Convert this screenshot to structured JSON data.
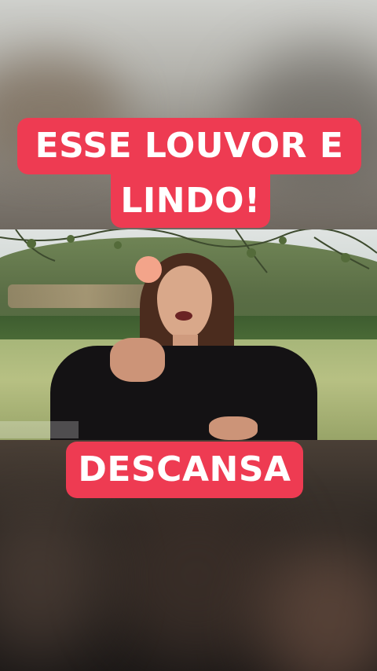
{
  "captions": {
    "top_line1": "ESSE LOUVOR E",
    "top_line2": "LINDO!",
    "bottom": "DESCANSA"
  },
  "colors": {
    "caption_bg": "#ee3b52",
    "caption_text": "#ffffff"
  }
}
